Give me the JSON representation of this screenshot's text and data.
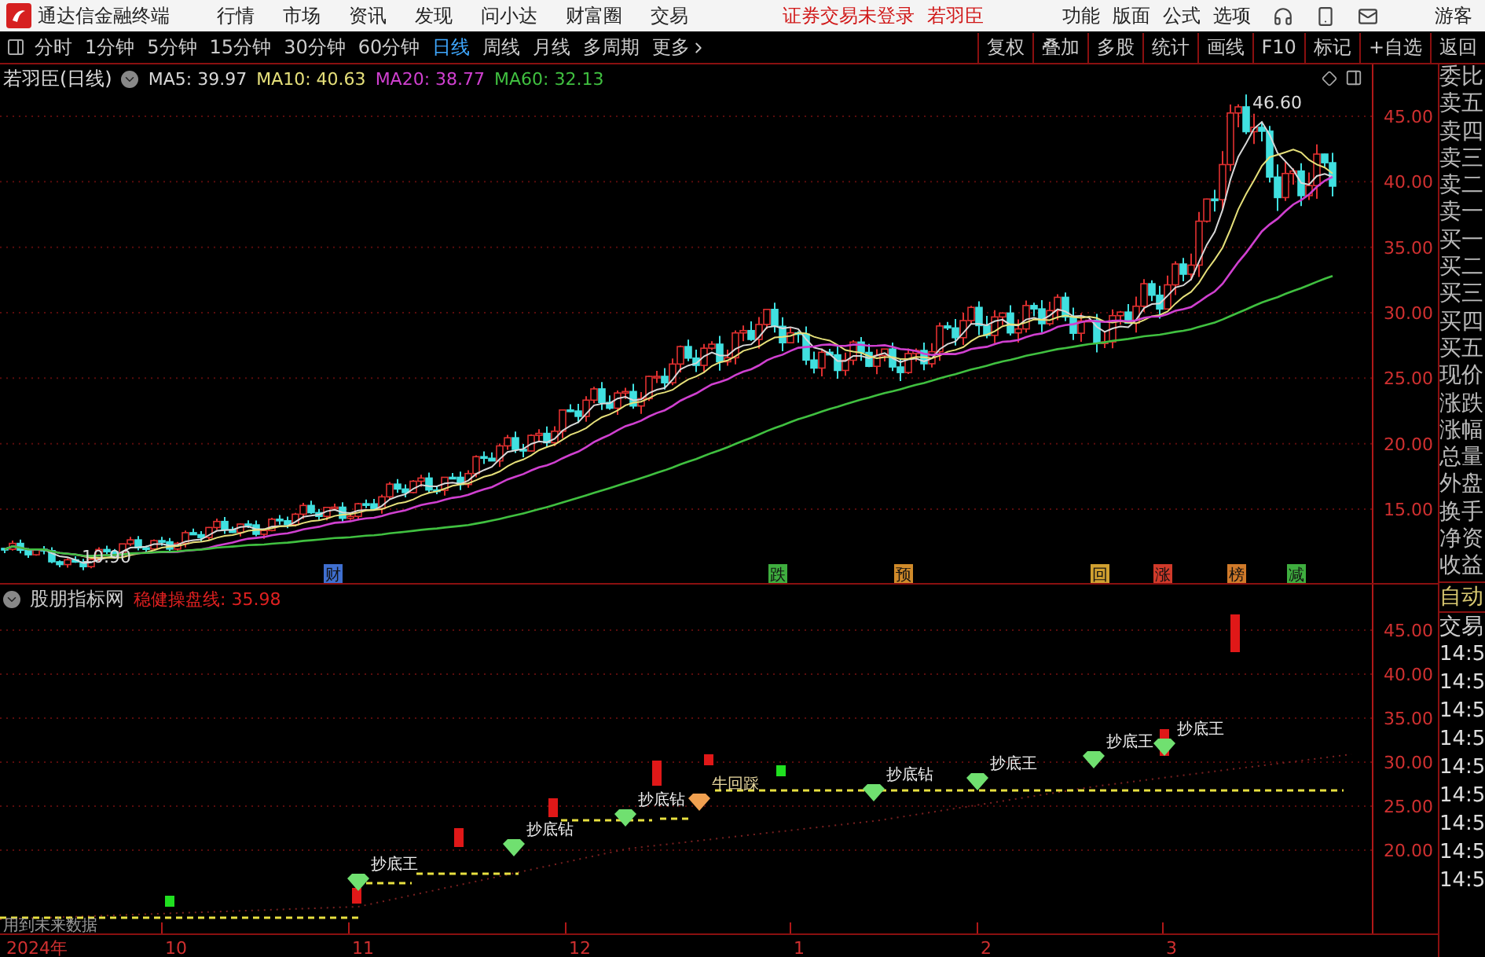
{
  "app": {
    "name": "通达信金融终端",
    "menu": [
      "行情",
      "市场",
      "资讯",
      "发现",
      "问小达",
      "财富圈",
      "交易"
    ],
    "login_status": "证券交易未登录",
    "user_name": "若羽臣",
    "tools": [
      "功能",
      "版面",
      "公式",
      "选项"
    ],
    "guest": "游客"
  },
  "periods": [
    {
      "label": "分时",
      "selected": false
    },
    {
      "label": "1分钟",
      "selected": false
    },
    {
      "label": "5分钟",
      "selected": false
    },
    {
      "label": "15分钟",
      "selected": false
    },
    {
      "label": "30分钟",
      "selected": false
    },
    {
      "label": "60分钟",
      "selected": false
    },
    {
      "label": "日线",
      "selected": true
    },
    {
      "label": "周线",
      "selected": false
    },
    {
      "label": "月线",
      "selected": false
    },
    {
      "label": "多周期",
      "selected": false
    }
  ],
  "more": "更多",
  "actions": [
    "复权",
    "叠加",
    "多股",
    "统计",
    "画线",
    "F10",
    "标记",
    "+自选",
    "返回"
  ],
  "main_chart": {
    "title": "若羽臣(日线)",
    "ma": [
      {
        "label": "MA5: 39.97",
        "color": "#d8d8d8"
      },
      {
        "label": "MA10: 40.63",
        "color": "#e6e07a"
      },
      {
        "label": "MA20: 38.77",
        "color": "#d040d0"
      },
      {
        "label": "MA60: 32.13",
        "color": "#40c040"
      }
    ],
    "high": "46.60",
    "low": "10.90",
    "yticks": [
      "45.00",
      "40.00",
      "35.00",
      "30.00",
      "25.00",
      "20.00",
      "15.00"
    ],
    "events": [
      {
        "label": "财",
        "color": "#3f6fd0"
      },
      {
        "label": "跌",
        "color": "#3fae3f"
      },
      {
        "label": "预",
        "color": "#d08a2a"
      },
      {
        "label": "回",
        "color": "#d0a030"
      },
      {
        "label": "涨",
        "color": "#d03a2a"
      },
      {
        "label": "榜",
        "color": "#d07a2a"
      },
      {
        "label": "减",
        "color": "#3fae3f"
      }
    ]
  },
  "indicator": {
    "name": "股朋指标网",
    "line": "稳健操盘线: 35.98",
    "yticks": [
      "45.00",
      "40.00",
      "35.00",
      "30.00",
      "25.00",
      "20.00"
    ],
    "signals": [
      {
        "label": "抄底王",
        "kind": "diamond"
      },
      {
        "label": "抄底钻",
        "kind": "diamond"
      },
      {
        "label": "抄底钻",
        "kind": "diamond"
      },
      {
        "label": "牛回踩",
        "kind": "bull"
      },
      {
        "label": "抄底钻",
        "kind": "diamond"
      },
      {
        "label": "抄底王",
        "kind": "diamond"
      },
      {
        "label": "抄底王",
        "kind": "diamond"
      },
      {
        "label": "抄底王",
        "kind": "diamond"
      }
    ],
    "note": "用到未来数据"
  },
  "time_axis": [
    "2024年",
    "10",
    "11",
    "12",
    "1",
    "2",
    "3"
  ],
  "quote_panel": {
    "fields": [
      "委比",
      "卖五",
      "卖四",
      "卖三",
      "卖二",
      "卖一",
      "买一",
      "买二",
      "买三",
      "买四",
      "买五",
      "现价",
      "涨跌",
      "涨幅",
      "总量",
      "外盘",
      "换手",
      "净资",
      "收益"
    ],
    "trade": [
      "自动",
      "交易"
    ],
    "ticks": [
      "14:5",
      "14:5",
      "14:5",
      "14:5",
      "14:5",
      "14:5",
      "14:5",
      "14:5",
      "14:5"
    ]
  }
}
